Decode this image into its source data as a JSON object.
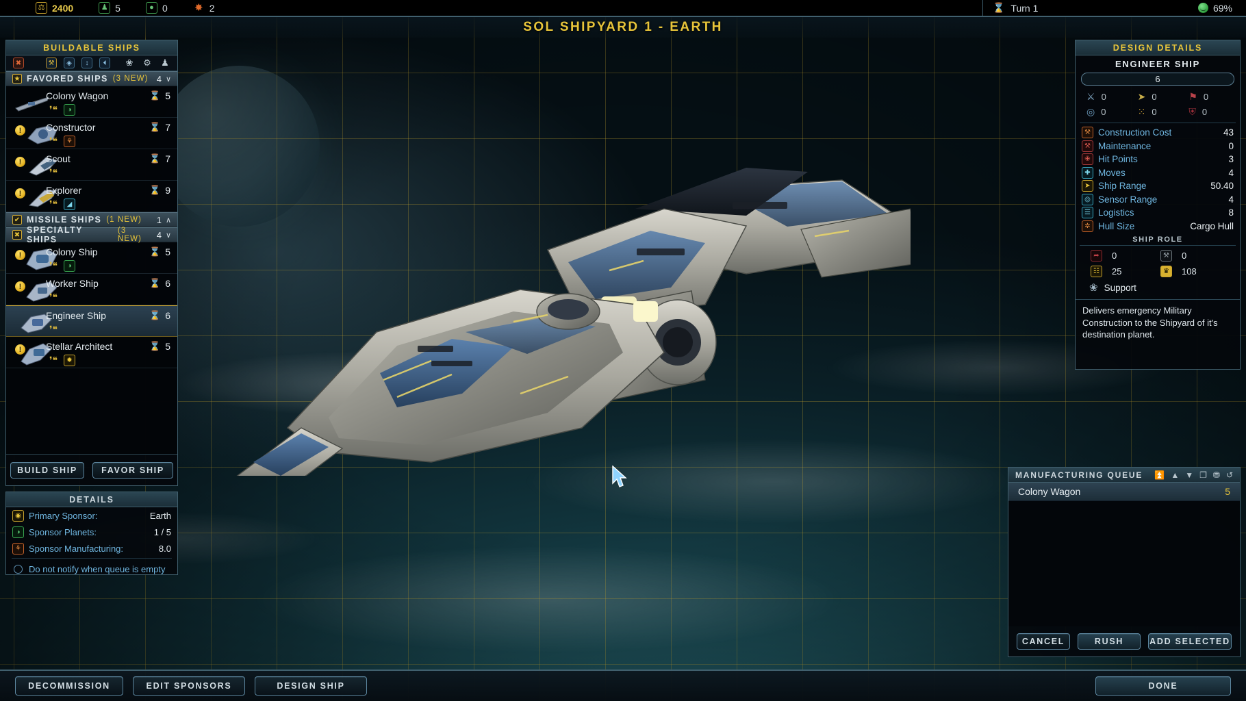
{
  "topbar": {
    "resources": [
      {
        "icon": "treasury-icon",
        "glyph": "⚖",
        "value": "2400",
        "style": "gold"
      },
      {
        "icon": "population-icon",
        "glyph": "♟",
        "value": "5",
        "style": "green"
      },
      {
        "icon": "food-icon",
        "glyph": "●",
        "value": "0",
        "style": "green"
      },
      {
        "icon": "influence-icon",
        "glyph": "✸",
        "value": "2",
        "style": "orange"
      }
    ],
    "turn_icon": "hourglass-icon",
    "turn_label": "Turn 1",
    "approval_icon": "smiley-icon",
    "approval_value": "69%"
  },
  "title": "Sol Shipyard 1 - Earth",
  "buildable": {
    "header": "Buildable Ships",
    "toolbar": [
      {
        "name": "clear-filter-icon",
        "glyph": "✖",
        "style": "red"
      },
      {
        "name": "hammer-filter-icon",
        "glyph": "⚒",
        "style": "gold"
      },
      {
        "name": "gem-filter-icon",
        "glyph": "◈",
        "style": "blue"
      },
      {
        "name": "sort-filter-icon",
        "glyph": "↕",
        "style": "blue"
      },
      {
        "name": "clock-filter-icon",
        "glyph": "◴",
        "style": "blue"
      }
    ],
    "toolbar_right": [
      {
        "name": "ship-role-icon",
        "glyph": "✈"
      },
      {
        "name": "gear-icon",
        "glyph": "⚙"
      },
      {
        "name": "person-icon",
        "glyph": "♟"
      }
    ],
    "groups": [
      {
        "name": "favored-ships",
        "label": "Favored Ships",
        "new_text": "(3 new)",
        "count": "4",
        "caret": "∨",
        "checkbox": "★",
        "ships": [
          {
            "name": "colony-wagon",
            "label": "Colony Wagon",
            "turns": "5",
            "alert": false,
            "badges": [
              {
                "style": "none",
                "glyph": "⚜"
              },
              {
                "style": "green",
                "glyph": "◑"
              }
            ]
          },
          {
            "name": "constructor",
            "label": "Constructor",
            "turns": "7",
            "alert": true,
            "badges": [
              {
                "style": "none",
                "glyph": "⚜"
              },
              {
                "style": "orange",
                "glyph": "☸"
              }
            ]
          },
          {
            "name": "scout",
            "label": "Scout",
            "turns": "7",
            "alert": true,
            "badges": [
              {
                "style": "none",
                "glyph": "➤"
              }
            ]
          },
          {
            "name": "explorer",
            "label": "Explorer",
            "turns": "9",
            "alert": true,
            "badges": [
              {
                "style": "none",
                "glyph": "➤"
              },
              {
                "style": "cyan",
                "glyph": "◢"
              }
            ]
          }
        ]
      },
      {
        "name": "missile-ships",
        "label": "Missile Ships",
        "new_text": "(1 new)",
        "count": "1",
        "caret": "∧",
        "checkbox": "✔",
        "ships": []
      },
      {
        "name": "specialty-ships",
        "label": "Specialty Ships",
        "new_text": "(3 new)",
        "count": "4",
        "caret": "∨",
        "checkbox": "✘",
        "ships": [
          {
            "name": "colony-ship",
            "label": "Colony Ship",
            "turns": "5",
            "alert": true,
            "badges": [
              {
                "style": "none",
                "glyph": "⚜"
              },
              {
                "style": "green",
                "glyph": "◑"
              }
            ]
          },
          {
            "name": "worker-ship",
            "label": "Worker Ship",
            "turns": "6",
            "alert": true,
            "badges": [
              {
                "style": "none",
                "glyph": "➤"
              }
            ]
          },
          {
            "name": "engineer-ship",
            "label": "Engineer Ship",
            "turns": "6",
            "alert": false,
            "selected": true,
            "badges": [
              {
                "style": "none",
                "glyph": "➤"
              }
            ]
          },
          {
            "name": "stellar-architect",
            "label": "Stellar Architect",
            "turns": "5",
            "alert": true,
            "badges": [
              {
                "style": "none",
                "glyph": "➤"
              },
              {
                "style": "gold",
                "glyph": "✹"
              }
            ]
          }
        ]
      }
    ],
    "build_button": "Build Ship",
    "favor_button": "Favor Ship"
  },
  "details": {
    "header": "Details",
    "rows": [
      {
        "icon": "sponsor-icon",
        "label": "Primary Sponsor:",
        "value": "Earth",
        "style": "gold"
      },
      {
        "icon": "planet-icon",
        "label": "Sponsor Planets:",
        "value": "1 / 5",
        "style": "green"
      },
      {
        "icon": "manufacturing-icon",
        "label": "Sponsor Manufacturing:",
        "value": "8.0",
        "style": "orange"
      }
    ],
    "checkbox_label": "Do not notify when queue is empty",
    "checkbox_checked": false
  },
  "design": {
    "header": "Design Details",
    "ship_name": "Engineer Ship",
    "bar_value": "6",
    "combat_stats": [
      {
        "name": "beam-weapon-stat",
        "glyph": "⚔",
        "value": "0",
        "color": "#7fa7c4"
      },
      {
        "name": "kinetic-weapon-stat",
        "glyph": "➤",
        "value": "0",
        "color": "#c9ae4a"
      },
      {
        "name": "missile-weapon-stat",
        "glyph": "⚑",
        "value": "0",
        "color": "#b8424a"
      },
      {
        "name": "shield-defense-stat",
        "glyph": "◎",
        "value": "0",
        "color": "#6f9fc2"
      },
      {
        "name": "point-defense-stat",
        "glyph": "⁙",
        "value": "0",
        "color": "#d2a63a"
      },
      {
        "name": "armor-defense-stat",
        "glyph": "⛨",
        "value": "0",
        "color": "#a5313c"
      }
    ],
    "lines": [
      {
        "icon": "construction-cost-icon",
        "glyph": "⚒",
        "style": "orange",
        "label": "Construction Cost",
        "value": "43"
      },
      {
        "icon": "maintenance-icon",
        "glyph": "⚒",
        "style": "red",
        "label": "Maintenance",
        "value": "0"
      },
      {
        "icon": "hit-points-icon",
        "glyph": "✙",
        "style": "red",
        "label": "Hit Points",
        "value": "3"
      },
      {
        "icon": "moves-icon",
        "glyph": "✚",
        "style": "cyan",
        "label": "Moves",
        "value": "4"
      },
      {
        "icon": "ship-range-icon",
        "glyph": "➤",
        "style": "gold",
        "label": "Ship Range",
        "value": "50.40"
      },
      {
        "icon": "sensor-range-icon",
        "glyph": "◎",
        "style": "cyan",
        "label": "Sensor Range",
        "value": "4"
      },
      {
        "icon": "logistics-icon",
        "glyph": "☰",
        "style": "cyan",
        "label": "Logistics",
        "value": "8"
      },
      {
        "icon": "hull-size-icon",
        "glyph": "✲",
        "style": "orange",
        "label": "Hull Size",
        "value": "Cargo Hull"
      }
    ],
    "role_title": "Ship Role",
    "role_stats": [
      {
        "name": "military-role-stat",
        "glyph": "➦",
        "style": "red",
        "value": "0"
      },
      {
        "name": "repair-role-stat",
        "glyph": "⚒",
        "style": "gray",
        "value": "0"
      },
      {
        "name": "cargo-role-stat",
        "glyph": "☷",
        "style": "gold",
        "value": "25"
      },
      {
        "name": "crown-role-stat",
        "glyph": "♛",
        "style": "gold",
        "value": "108"
      }
    ],
    "role_name": "Support",
    "role_icon": "support-icon",
    "description": "Delivers emergency Military Construction to the Shipyard of it's destination planet."
  },
  "queue": {
    "header": "Manufacturing Queue",
    "tools": [
      {
        "name": "move-to-top-icon",
        "glyph": "⏫"
      },
      {
        "name": "move-up-icon",
        "glyph": "▲"
      },
      {
        "name": "move-down-icon",
        "glyph": "▼"
      },
      {
        "name": "duplicate-icon",
        "glyph": "❐"
      },
      {
        "name": "delete-icon",
        "glyph": "⌧"
      },
      {
        "name": "repeat-icon",
        "glyph": "↺"
      }
    ],
    "items": [
      {
        "name": "queue-item-colony-wagon",
        "label": "Colony Wagon",
        "count": "5"
      }
    ],
    "buttons": [
      {
        "name": "cancel-button",
        "label": "Cancel",
        "style": "dim"
      },
      {
        "name": "rush-button",
        "label": "Rush",
        "style": "bright"
      },
      {
        "name": "add-selected-button",
        "label": "Add Selected",
        "style": "bright"
      }
    ]
  },
  "bottombar": {
    "left_buttons": [
      {
        "name": "decommission-button",
        "label": "Decommission"
      },
      {
        "name": "edit-sponsors-button",
        "label": "Edit Sponsors"
      },
      {
        "name": "design-ship-button",
        "label": "Design Ship"
      }
    ],
    "done_button": "Done"
  },
  "colors": {
    "accent_gold": "#e8c53a",
    "panel_border": "#41606e",
    "label_blue": "#6fb6e0"
  }
}
